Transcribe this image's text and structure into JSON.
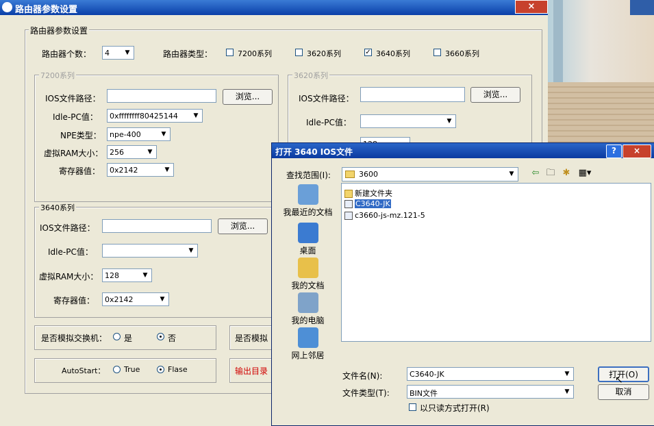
{
  "main_window": {
    "title": "路由器参数设置",
    "close": "×",
    "router_group_title": "路由器参数设置",
    "router_count_label": "路由器个数：",
    "router_count_value": "4",
    "router_type_label": "路由器类型：",
    "router_types": [
      {
        "label": "7200系列",
        "checked": false,
        "mark": ""
      },
      {
        "label": "3620系列",
        "checked": false,
        "mark": ""
      },
      {
        "label": "3640系列",
        "checked": true,
        "mark": "✓"
      },
      {
        "label": "3660系列",
        "checked": false,
        "mark": ""
      }
    ],
    "g7200": {
      "title": "7200系列",
      "ios_path_label": "IOS文件路径：",
      "browse": "浏览...",
      "idlepc_label": "Idle-PC值：",
      "idlepc_value": "0xffffffff80425144",
      "npe_label": "NPE类型：",
      "npe_value": "npe-400",
      "ram_label": "虚拟RAM大小：",
      "ram_value": "256",
      "reg_label": "寄存器值：",
      "reg_value": "0x2142"
    },
    "g3620": {
      "title": "3620系列",
      "ios_path_label": "IOS文件路径：",
      "browse": "浏览...",
      "idlepc_label": "Idle-PC值：",
      "ram_value": "128"
    },
    "g3640": {
      "title": "3640系列",
      "ios_path_label": "IOS文件路径：",
      "browse": "浏览...",
      "idlepc_label": "Idle-PC值：",
      "ram_label": "虚拟RAM大小：",
      "ram_value": "128",
      "reg_label": "寄存器值：",
      "reg_value": "0x2142"
    },
    "switch_label": "是否模拟交换机：",
    "switch_yes": "是",
    "switch_no": "否",
    "switch_partial": "是否模拟",
    "autostart_label": "AutoStart：",
    "autostart_true": "True",
    "autostart_false": "Flase",
    "output_dir": "输出目录"
  },
  "dialog": {
    "title": "打开 3640 IOS文件",
    "help": "?",
    "close": "×",
    "lookin_label": "查找范围(I):",
    "lookin_value": "3600",
    "places": [
      {
        "label": "我最近的文档",
        "icon": "recent-docs-icon",
        "color": "#6a9fd8"
      },
      {
        "label": "桌面",
        "icon": "desktop-icon",
        "color": "#3b7bd1"
      },
      {
        "label": "我的文档",
        "icon": "my-documents-icon",
        "color": "#e8c04a"
      },
      {
        "label": "我的电脑",
        "icon": "my-computer-icon",
        "color": "#7fa3c9"
      },
      {
        "label": "网上邻居",
        "icon": "network-places-icon",
        "color": "#4e8fd6"
      }
    ],
    "files": [
      {
        "name": "新建文件夹",
        "type": "folder",
        "selected": false
      },
      {
        "name": "C3640-JK",
        "type": "file",
        "selected": true
      },
      {
        "name": "c3660-js-mz.121-5",
        "type": "file",
        "selected": false
      }
    ],
    "filename_label": "文件名(N):",
    "filename_value": "C3640-JK",
    "filetype_label": "文件类型(T):",
    "filetype_value": "BIN文件",
    "readonly_label": "以只读方式打开(R)",
    "open_button": "打开(O)",
    "cancel_button": "取消"
  }
}
